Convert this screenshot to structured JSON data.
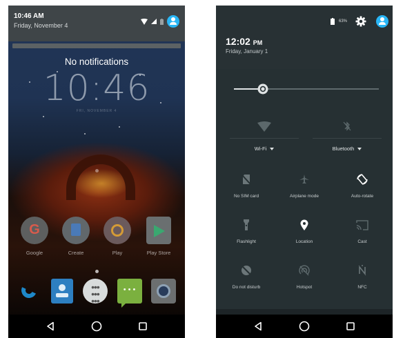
{
  "left_phone": {
    "status_bar": {
      "time": "10:46 AM",
      "date": "Friday, November 4"
    },
    "notification_text": "No notifications",
    "lock_clock": "10:46",
    "lock_date": "FRI, NOVEMBER 4",
    "apps": [
      {
        "label": "Google",
        "icon": "google-icon"
      },
      {
        "label": "Create",
        "icon": "docs-icon"
      },
      {
        "label": "Play",
        "icon": "play-icon"
      },
      {
        "label": "Play Store",
        "icon": "play-store-icon"
      }
    ],
    "dock": [
      "phone-icon",
      "contacts-icon",
      "app-drawer-icon",
      "messenger-icon",
      "camera-icon"
    ],
    "navigation": [
      "back-icon",
      "home-icon",
      "recents-icon"
    ]
  },
  "right_phone": {
    "status_bar": {
      "battery": "63%"
    },
    "time": "12:02",
    "time_suffix": "PM",
    "date": "Friday, January 1",
    "brightness_level": 0.2,
    "wifi_label": "Wi-Fi",
    "bluetooth_label": "Bluetooth",
    "tiles": [
      {
        "label": "No SIM card",
        "icon": "no-sim-icon"
      },
      {
        "label": "Airplane mode",
        "icon": "airplane-icon"
      },
      {
        "label": "Auto-rotate",
        "icon": "auto-rotate-icon"
      },
      {
        "label": "Flashlight",
        "icon": "flashlight-icon"
      },
      {
        "label": "Location",
        "icon": "location-icon"
      },
      {
        "label": "Cast",
        "icon": "cast-icon"
      },
      {
        "label": "Do not disturb",
        "icon": "do-not-disturb-icon"
      },
      {
        "label": "Hotspot",
        "icon": "hotspot-icon"
      },
      {
        "label": "NFC",
        "icon": "nfc-icon"
      }
    ]
  },
  "colors": {
    "accent": "#29b6f6",
    "panel": "#263033",
    "header": "#283134"
  }
}
